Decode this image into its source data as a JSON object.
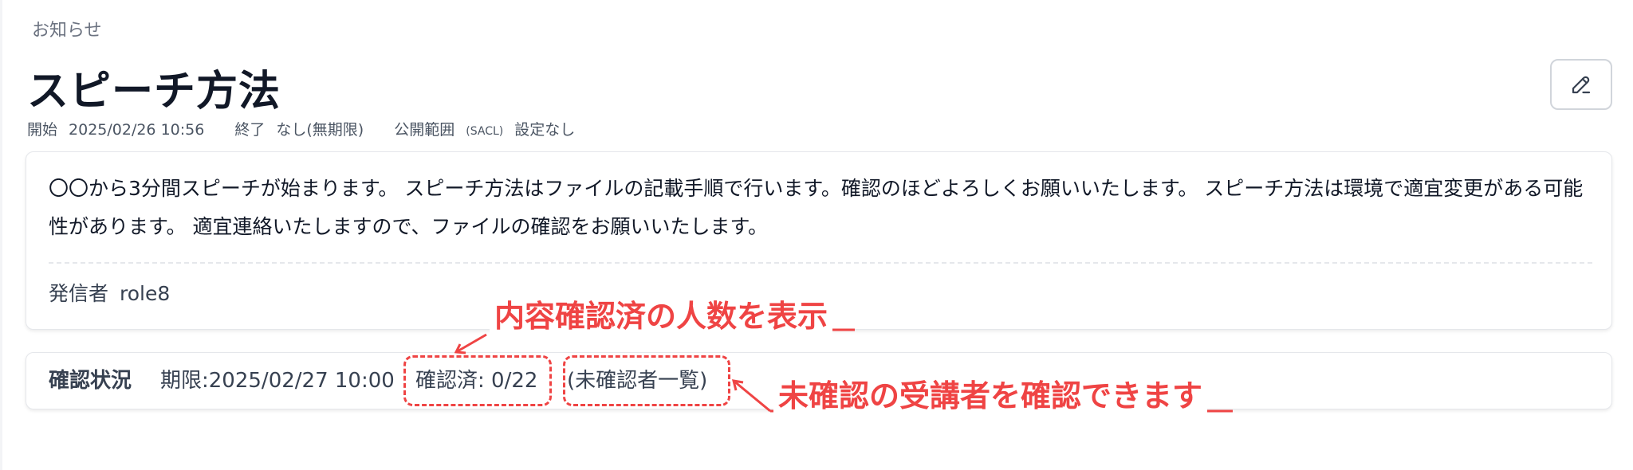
{
  "header": {
    "breadcrumb": "お知らせ",
    "title": "スピーチ方法"
  },
  "meta": {
    "start_label": "開始",
    "start_value": "2025/02/26 10:56",
    "end_label": "終了",
    "end_value": "なし(無期限)",
    "scope_label": "公開範囲",
    "scope_tag": "(SACL)",
    "scope_value": "設定なし"
  },
  "message": {
    "body": "〇〇から3分間スピーチが始まります。 スピーチ方法はファイルの記載手順で行います。確認のほどよろしくお願いいたします。 スピーチ方法は環境で適宜変更がある可能性があります。 適宜連絡いたしますので、ファイルの確認をお願いいたします。",
    "sender_label": "発信者",
    "sender_value": "role8"
  },
  "status": {
    "title": "確認状況",
    "deadline": "期限:2025/02/27 10:00",
    "confirmed_count": "確認済: 0/22",
    "unconfirmed_link": "(未確認者一覧)"
  },
  "annotations": {
    "count_note": "内容確認済の人数を表示",
    "list_note": "未確認の受講者を確認できます",
    "color": "#ef4444"
  },
  "icons": {
    "edit": "edit-pencil-icon"
  }
}
